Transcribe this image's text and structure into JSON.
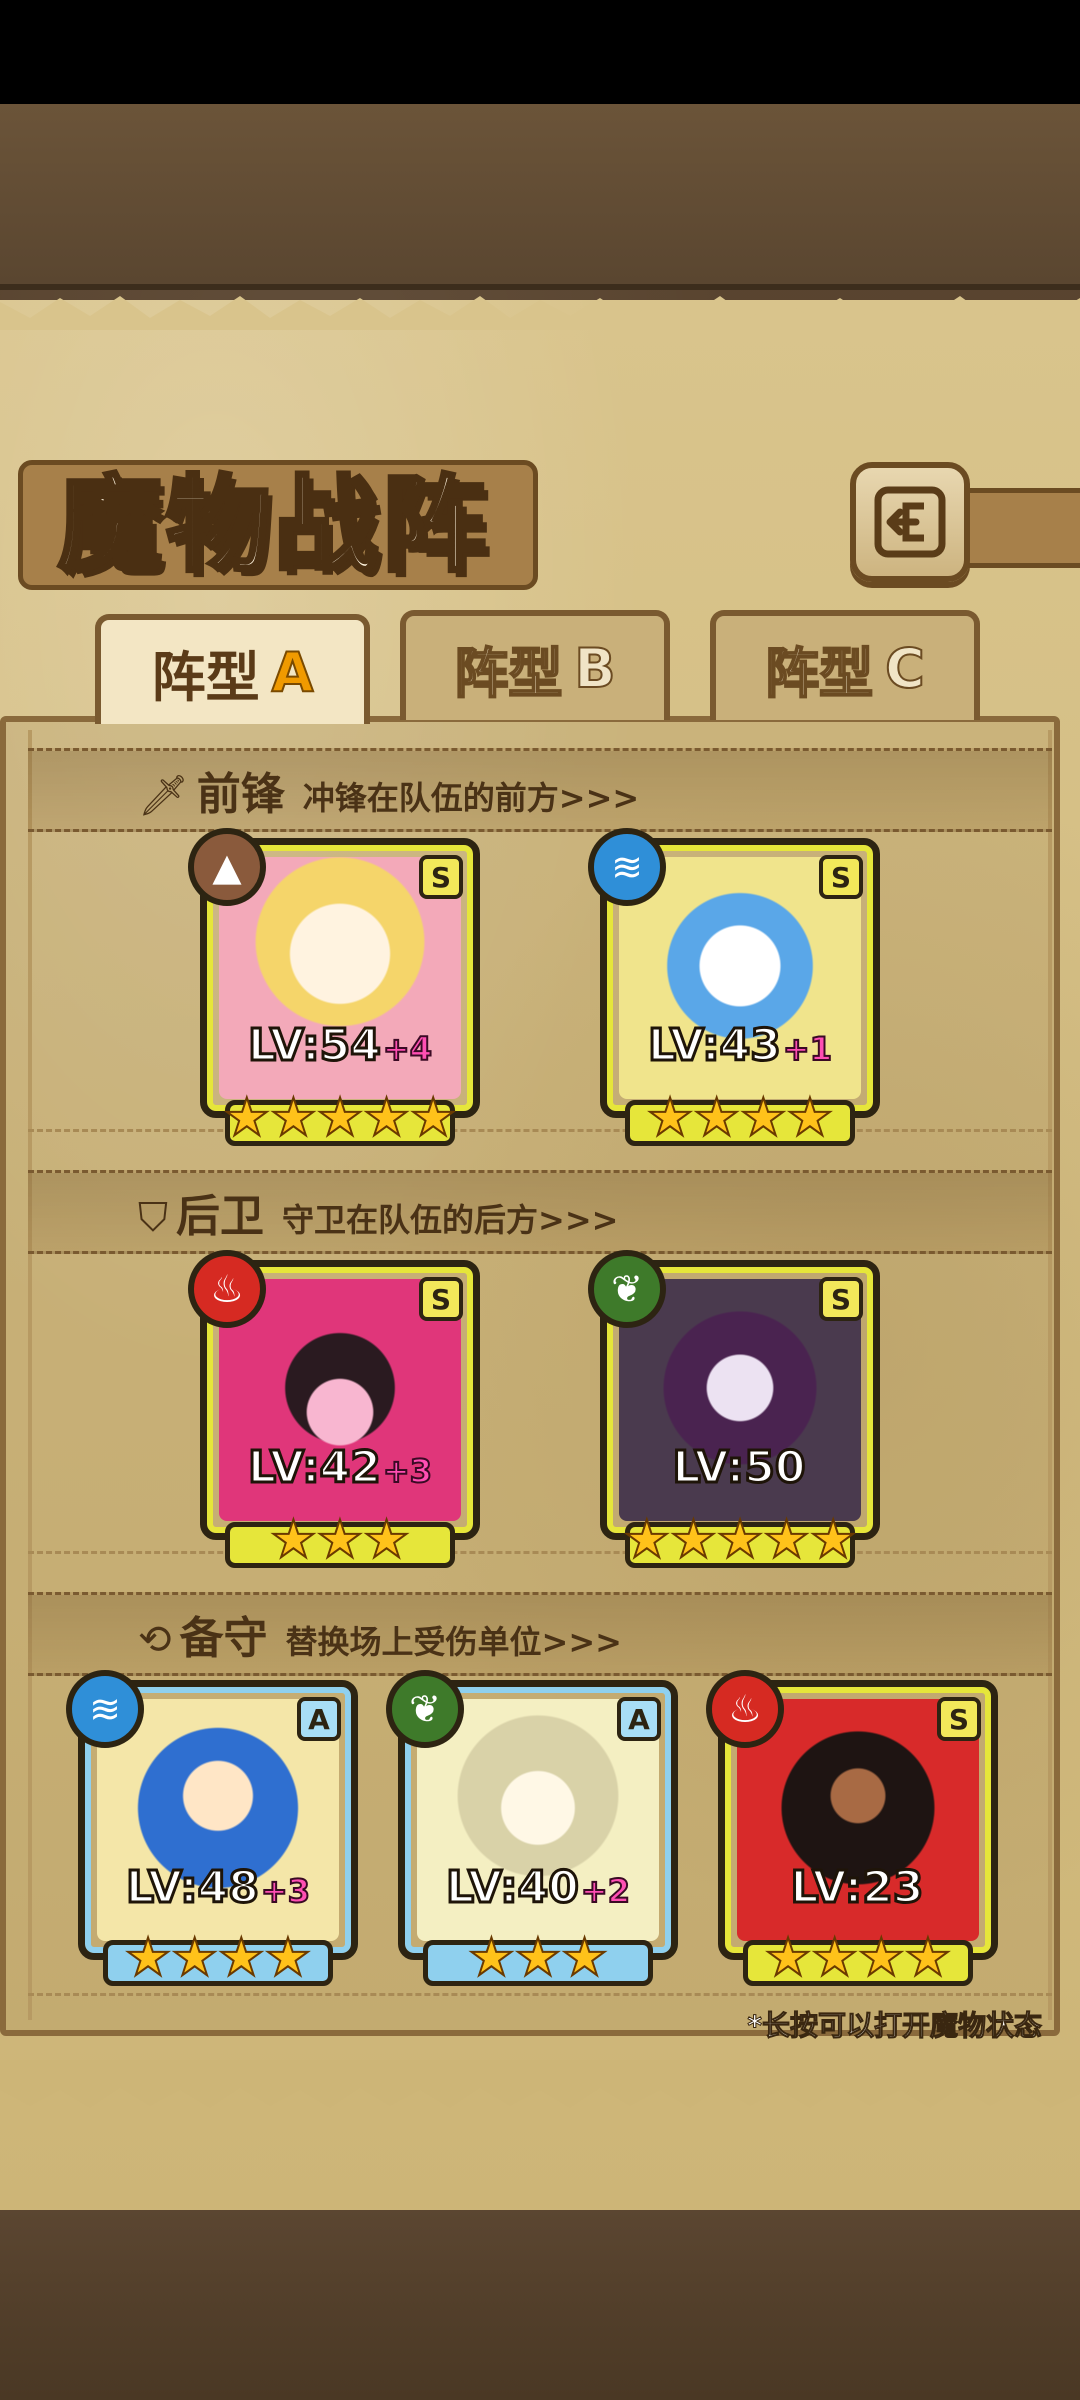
{
  "header": {
    "title": "魔物战阵",
    "back_icon": "back-arrow-icon"
  },
  "tabs": [
    {
      "label": "阵型",
      "letter": "A",
      "selected": true
    },
    {
      "label": "阵型",
      "letter": "B",
      "selected": false
    },
    {
      "label": "阵型",
      "letter": "C",
      "selected": false
    }
  ],
  "sections": {
    "front": {
      "icon": "sword-icon",
      "title": "前锋",
      "desc": "冲锋在队伍的前方>>>"
    },
    "rear": {
      "icon": "shield-icon",
      "title": "后卫",
      "desc": "守卫在队伍的后方>>>"
    },
    "reserve": {
      "icon": "swap-icon",
      "title": "备守",
      "desc": "替换场上受伤单位>>>"
    }
  },
  "front_units": [
    {
      "element": "earth",
      "rank": "S",
      "lv": "LV:54",
      "plus": "+4",
      "stars": "★★★★★"
    },
    {
      "element": "water",
      "rank": "S",
      "lv": "LV:43",
      "plus": "+1",
      "stars": "★★★★"
    }
  ],
  "rear_units": [
    {
      "element": "fire",
      "rank": "S",
      "lv": "LV:42",
      "plus": "+3",
      "stars": "★★★"
    },
    {
      "element": "plant",
      "rank": "S",
      "lv": "LV:50",
      "plus": "",
      "stars": "★★★★★"
    }
  ],
  "reserve_units": [
    {
      "element": "water",
      "rank": "A",
      "lv": "LV:48",
      "plus": "+3",
      "stars": "★★★★"
    },
    {
      "element": "plant",
      "rank": "A",
      "lv": "LV:40",
      "plus": "+2",
      "stars": "★★★"
    },
    {
      "element": "fire",
      "rank": "S",
      "lv": "LV:23",
      "plus": "",
      "stars": "★★★★"
    }
  ],
  "hint": "*长按可以打开魔物状态",
  "colors": {
    "frame_yellow": "#e6e63a",
    "frame_blue": "#8fd0ee",
    "accent_orange": "#f09a00",
    "plus_pink": "#ff4fb3"
  }
}
